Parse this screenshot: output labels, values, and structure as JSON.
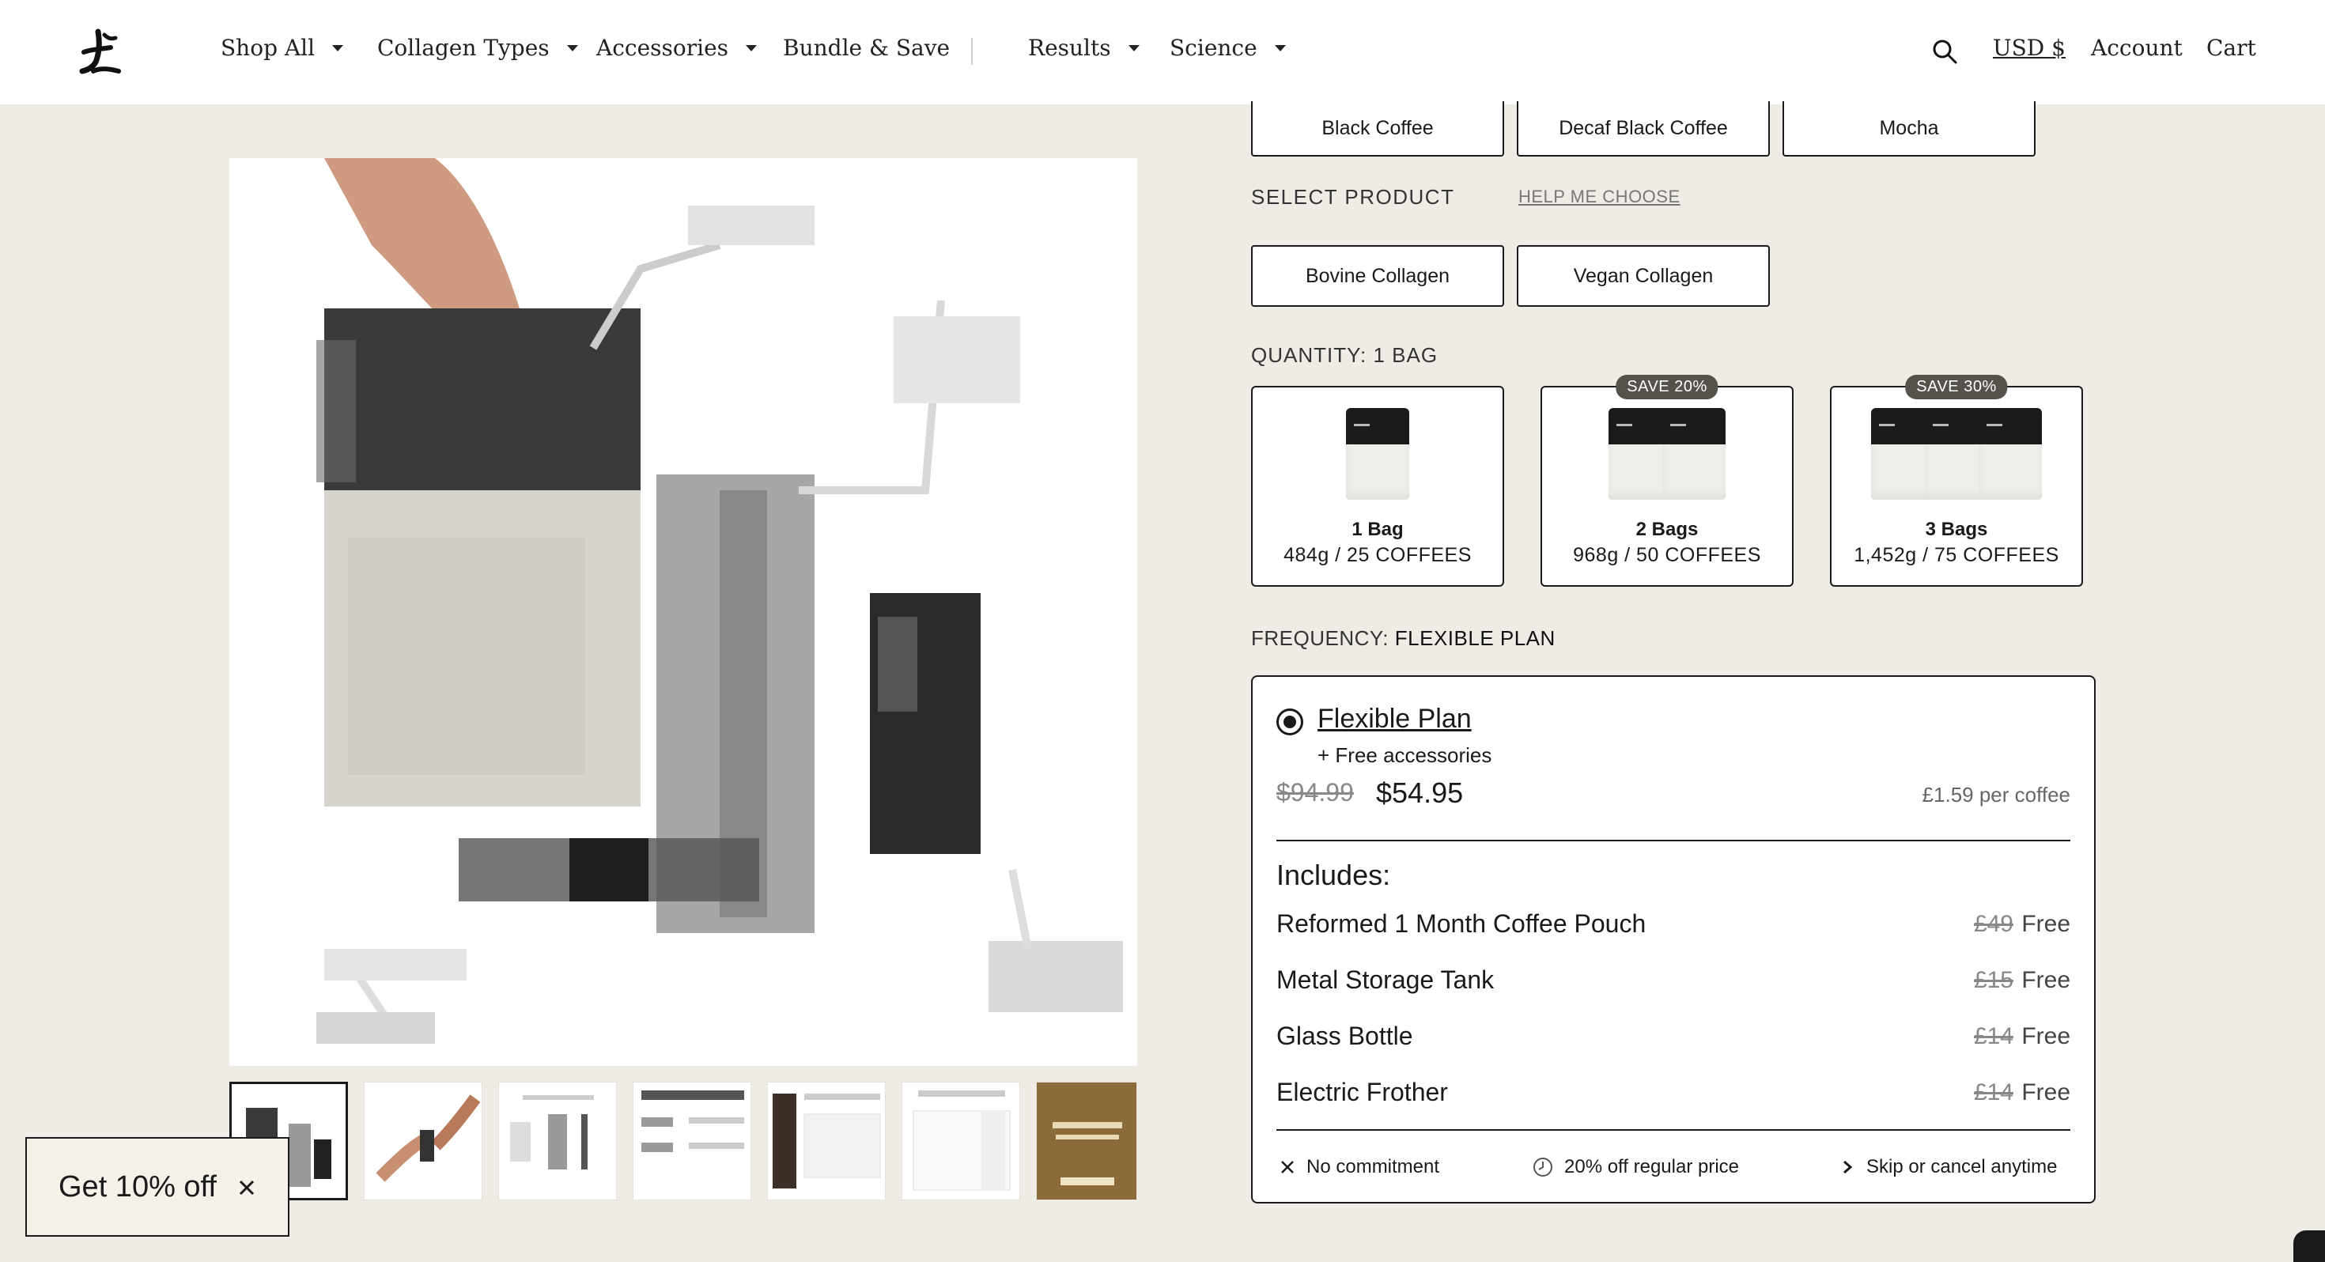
{
  "header": {
    "nav": [
      {
        "label": "Shop All",
        "caret": true
      },
      {
        "label": "Collagen Types",
        "caret": true
      },
      {
        "label": "Accessories",
        "caret": true
      },
      {
        "label": "Bundle & Save",
        "caret": false
      },
      {
        "label": "Results",
        "caret": true
      },
      {
        "label": "Science",
        "caret": true
      }
    ],
    "currency": "USD $",
    "account": "Account",
    "cart": "Cart"
  },
  "flavors": [
    "Black Coffee",
    "Decaf Black Coffee",
    "Mocha"
  ],
  "select_product": {
    "label": "SELECT PRODUCT",
    "help": "HELP ME CHOOSE",
    "options": [
      "Bovine Collagen",
      "Vegan Collagen"
    ]
  },
  "quantity": {
    "label": "QUANTITY:",
    "value": "1 BAG",
    "options": [
      {
        "title": "1 Bag",
        "sub": "484g / 25 COFFEES",
        "badge": "",
        "pouches": 1
      },
      {
        "title": "2 Bags",
        "sub": "968g / 50 COFFEES",
        "badge": "SAVE 20%",
        "pouches": 2
      },
      {
        "title": "3 Bags",
        "sub": "1,452g / 75 COFFEES",
        "badge": "SAVE 30%",
        "pouches": 3
      }
    ]
  },
  "frequency": {
    "label": "FREQUENCY:",
    "value": "FLEXIBLE PLAN"
  },
  "plan": {
    "title": "Flexible Plan",
    "extra": "+ Free accessories",
    "old_price": "$94.99",
    "price": "$54.95",
    "per_coffee": "£1.59 per coffee",
    "includes_title": "Includes:",
    "includes": [
      {
        "name": "Reformed 1 Month Coffee Pouch",
        "old": "£49",
        "now": "Free"
      },
      {
        "name": "Metal Storage Tank",
        "old": "£15",
        "now": "Free"
      },
      {
        "name": "Glass Bottle",
        "old": "£14",
        "now": "Free"
      },
      {
        "name": "Electric Frother",
        "old": "£14",
        "now": "Free"
      }
    ],
    "features": [
      "No commitment",
      "20% off regular price",
      "Skip or cancel anytime"
    ]
  },
  "discount": {
    "label": "Get 10% off"
  },
  "colors": {
    "background": "#efebe5",
    "ink": "#1a1a1a",
    "badge": "#55524b"
  },
  "icons": [
    "logo-icon",
    "search-icon",
    "close-icon",
    "clock-icon",
    "chevron-right-icon",
    "chevron-down-icon"
  ]
}
